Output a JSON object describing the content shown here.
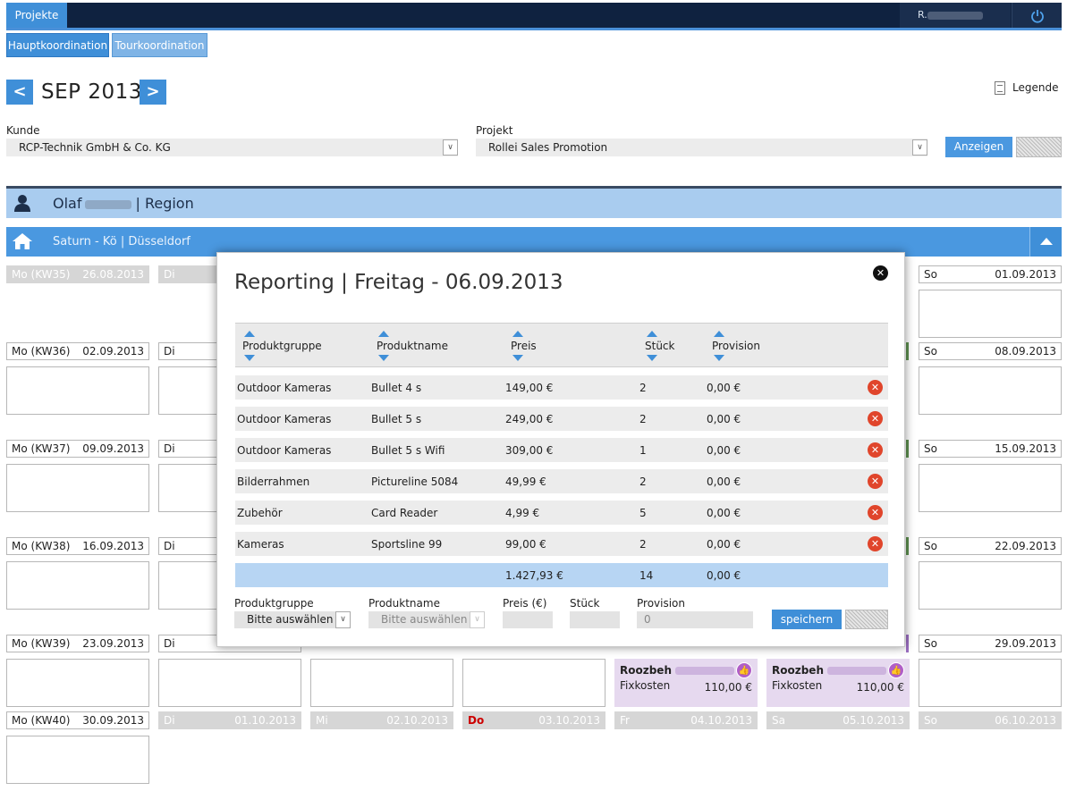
{
  "header": {
    "tab_projekte": "Projekte",
    "user": "R.",
    "power_icon": "power-icon"
  },
  "subtabs": [
    "Hauptkoordination",
    "Tourkoordination"
  ],
  "month": "SEP 2013",
  "nav": {
    "prev": "<",
    "next": ">"
  },
  "legende": "Legende",
  "filters": {
    "kunde_label": "Kunde",
    "kunde_value": "RCP-Technik GmbH & Co. KG",
    "projekt_label": "Projekt",
    "projekt_value": "Rollei Sales Promotion",
    "anzeigen": "Anzeigen"
  },
  "region": {
    "first": "Olaf",
    "suffix": "| Region"
  },
  "store": "Saturn - Kö | Düsseldorf",
  "calendar": {
    "row35": {
      "mo": "Mo (KW35)",
      "mo_date": "26.08.2013",
      "di": "Di",
      "so": "So",
      "so_date": "01.09.2013"
    },
    "row36": {
      "mo": "Mo (KW36)",
      "mo_date": "02.09.2013",
      "di": "Di",
      "so": "So",
      "so_date": "08.09.2013"
    },
    "row37": {
      "mo": "Mo (KW37)",
      "mo_date": "09.09.2013",
      "di": "Di",
      "so": "So",
      "so_date": "15.09.2013"
    },
    "row38": {
      "mo": "Mo (KW38)",
      "mo_date": "16.09.2013",
      "di": "Di",
      "so": "So",
      "so_date": "22.09.2013"
    },
    "row39": {
      "mo": "Mo (KW39)",
      "mo_date": "23.09.2013",
      "di": "Di",
      "so": "So",
      "so_date": "29.09.2013"
    },
    "row40": {
      "mo": "Mo (KW40)",
      "mo_date": "30.09.2013",
      "di": "Di",
      "di_date": "01.10.2013",
      "mi": "Mi",
      "mi_date": "02.10.2013",
      "do": "Do",
      "do_date": "03.10.2013",
      "fr": "Fr",
      "fr_date": "04.10.2013",
      "sa": "Sa",
      "sa_date": "05.10.2013",
      "so": "So",
      "so_date": "06.10.2013"
    },
    "entries": [
      {
        "name": "Roozbeh",
        "type": "Fixkosten",
        "amount": "110,00 €"
      },
      {
        "name": "Roozbeh",
        "type": "Fixkosten",
        "amount": "110,00 €"
      }
    ]
  },
  "modal": {
    "title": "Reporting | Freitag - 06.09.2013",
    "columns": [
      "Produktgruppe",
      "Produktname",
      "Preis",
      "Stück",
      "Provision"
    ],
    "rows": [
      {
        "gruppe": "Outdoor Kameras",
        "name": "Bullet 4 s",
        "preis": "149,00 €",
        "stueck": "2",
        "provision": "0,00 €"
      },
      {
        "gruppe": "Outdoor Kameras",
        "name": "Bullet 5 s",
        "preis": "249,00 €",
        "stueck": "2",
        "provision": "0,00 €"
      },
      {
        "gruppe": "Outdoor Kameras",
        "name": "Bullet 5 s Wifi",
        "preis": "309,00 €",
        "stueck": "1",
        "provision": "0,00 €"
      },
      {
        "gruppe": "Bilderrahmen",
        "name": "Pictureline 5084",
        "preis": "49,99 €",
        "stueck": "2",
        "provision": "0,00 €"
      },
      {
        "gruppe": "Zubehör",
        "name": "Card Reader",
        "preis": "4,99 €",
        "stueck": "5",
        "provision": "0,00 €"
      },
      {
        "gruppe": "Kameras",
        "name": "Sportsline 99",
        "preis": "99,00 €",
        "stueck": "2",
        "provision": "0,00 €"
      }
    ],
    "total": {
      "preis": "1.427,93 €",
      "stueck": "14",
      "provision": "0,00 €"
    },
    "form": {
      "gruppe_label": "Produktgruppe",
      "gruppe_value": "Bitte auswählen",
      "name_label": "Produktname",
      "name_value": "Bitte auswählen",
      "preis_label": "Preis (€)",
      "stueck_label": "Stück",
      "provision_label": "Provision",
      "provision_value": "0",
      "save": "speichern"
    }
  }
}
